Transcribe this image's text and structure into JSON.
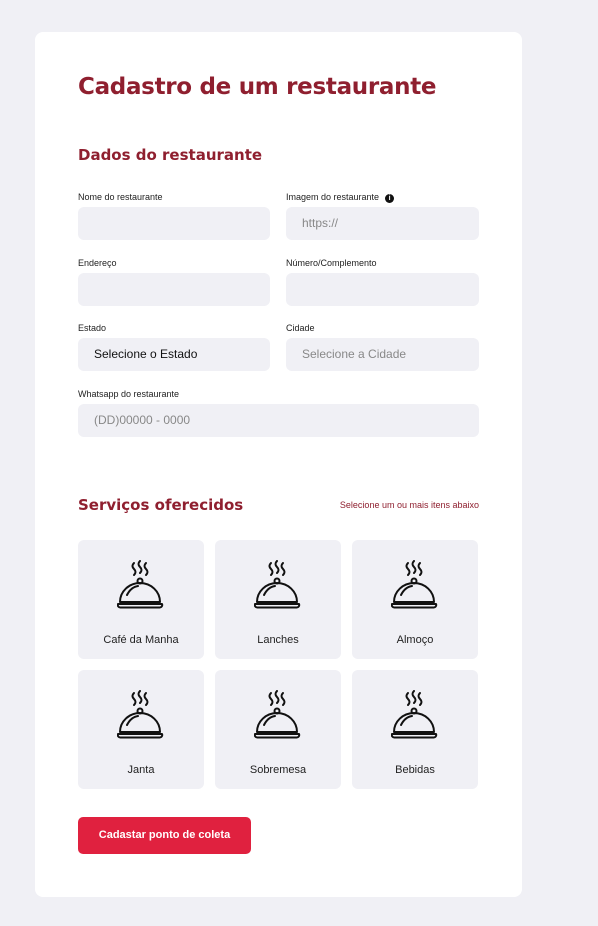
{
  "page": {
    "title": "Cadastro de um restaurante"
  },
  "restaurant_section": {
    "title": "Dados do restaurante",
    "fields": {
      "name": {
        "label": "Nome do restaurante",
        "value": "",
        "placeholder": ""
      },
      "image": {
        "label": "Imagem do restaurante",
        "value": "",
        "placeholder": "https://"
      },
      "address": {
        "label": "Endereço",
        "value": "",
        "placeholder": ""
      },
      "number": {
        "label": "Número/Complemento",
        "value": "",
        "placeholder": ""
      },
      "state": {
        "label": "Estado",
        "selected": "Selecione o Estado"
      },
      "city": {
        "label": "Cidade",
        "selected": "Selecione a Cidade"
      },
      "whatsapp": {
        "label": "Whatsapp do restaurante",
        "value": "",
        "placeholder": "(DD)00000 - 0000"
      }
    }
  },
  "services_section": {
    "title": "Serviços oferecidos",
    "hint": "Selecione um ou mais itens abaixo",
    "items": [
      {
        "label": "Café da Manha",
        "icon": "cloche-icon"
      },
      {
        "label": "Lanches",
        "icon": "cloche-icon"
      },
      {
        "label": "Almoço",
        "icon": "cloche-icon"
      },
      {
        "label": "Janta",
        "icon": "cloche-icon"
      },
      {
        "label": "Sobremesa",
        "icon": "cloche-icon"
      },
      {
        "label": "Bebidas",
        "icon": "cloche-icon"
      }
    ]
  },
  "submit": {
    "label": "Cadastar ponto de coleta"
  },
  "colors": {
    "accent": "#8f1f2f",
    "button": "#e0213f",
    "input_bg": "#f0f0f5",
    "page_bg": "#f0f0f5"
  }
}
